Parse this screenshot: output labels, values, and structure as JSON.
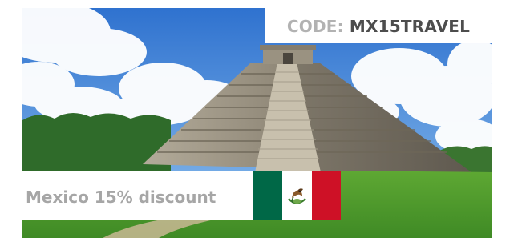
{
  "promo": {
    "code_label": "CODE:",
    "code_value": "MX15TRAVEL",
    "discount_text": "Mexico 15% discount"
  },
  "flag": {
    "country": "Mexico",
    "colors": {
      "green": "#006847",
      "white": "#ffffff",
      "red": "#ce1126"
    }
  },
  "colors": {
    "code_label": "#b2b2b2",
    "code_value": "#4d4d4d",
    "discount_text": "#a6a6a6",
    "sky": "#3b82d9",
    "grass": "#4e9a2c",
    "stone": "#9d9585"
  },
  "icons": {
    "flag": "mexico-flag-icon",
    "photo": "pyramid-photo"
  }
}
